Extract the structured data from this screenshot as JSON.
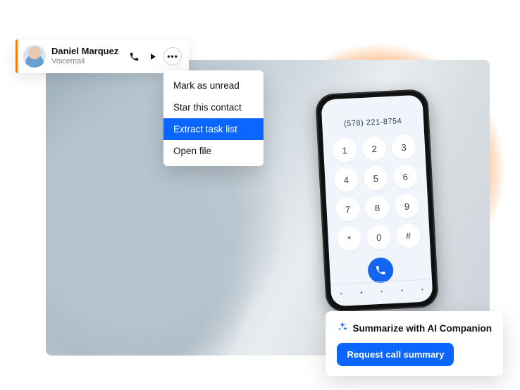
{
  "voicemail_card": {
    "name": "Daniel Marquez",
    "sub": "Voicemail"
  },
  "dropdown": {
    "items": [
      {
        "label": "Mark as unread",
        "selected": false
      },
      {
        "label": "Star this contact",
        "selected": false
      },
      {
        "label": "Extract task list",
        "selected": true
      },
      {
        "label": "Open file",
        "selected": false
      }
    ]
  },
  "ai_card": {
    "title": "Summarize with AI Companion",
    "button_label": "Request call summary"
  },
  "phone": {
    "number": "(578) 221-8754",
    "keys": [
      "1",
      "2",
      "3",
      "4",
      "5",
      "6",
      "7",
      "8",
      "9",
      "*",
      "0",
      "#"
    ]
  },
  "colors": {
    "accent_blue": "#0b66ff",
    "accent_orange": "#ff7a00"
  }
}
